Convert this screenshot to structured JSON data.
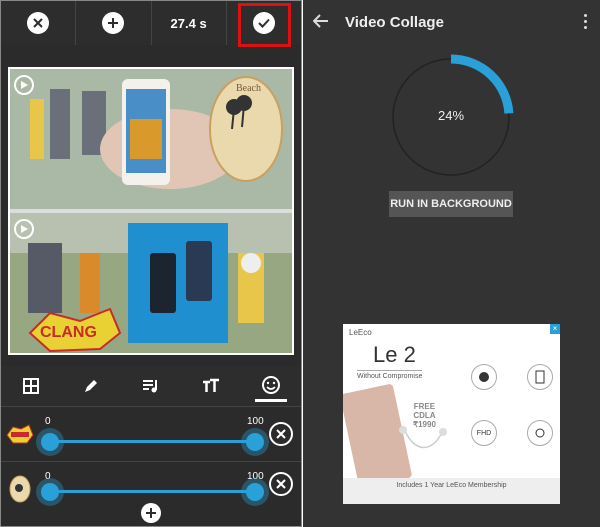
{
  "left": {
    "toolbar": {
      "time": "27.4 s"
    },
    "stickers": [
      {
        "min_label": "0",
        "max_label": "100"
      },
      {
        "min_label": "0",
        "max_label": "100"
      }
    ]
  },
  "right": {
    "title": "Video Collage",
    "progress_text": "24%",
    "progress": 0.24,
    "background_button": "RUN IN BACKGROUND",
    "ad": {
      "brand": "LeEco",
      "headline": "Le 2",
      "tagline": "Without Compromise",
      "offer_line1": "FREE",
      "offer_line2": "CDLA",
      "offer_line3": "₹1990",
      "feature_fhd": "FHD",
      "bottom": "Includes 1 Year LeEco Membership"
    }
  },
  "colors": {
    "accent": "#29a0d8",
    "highlight": "#dd1111"
  }
}
